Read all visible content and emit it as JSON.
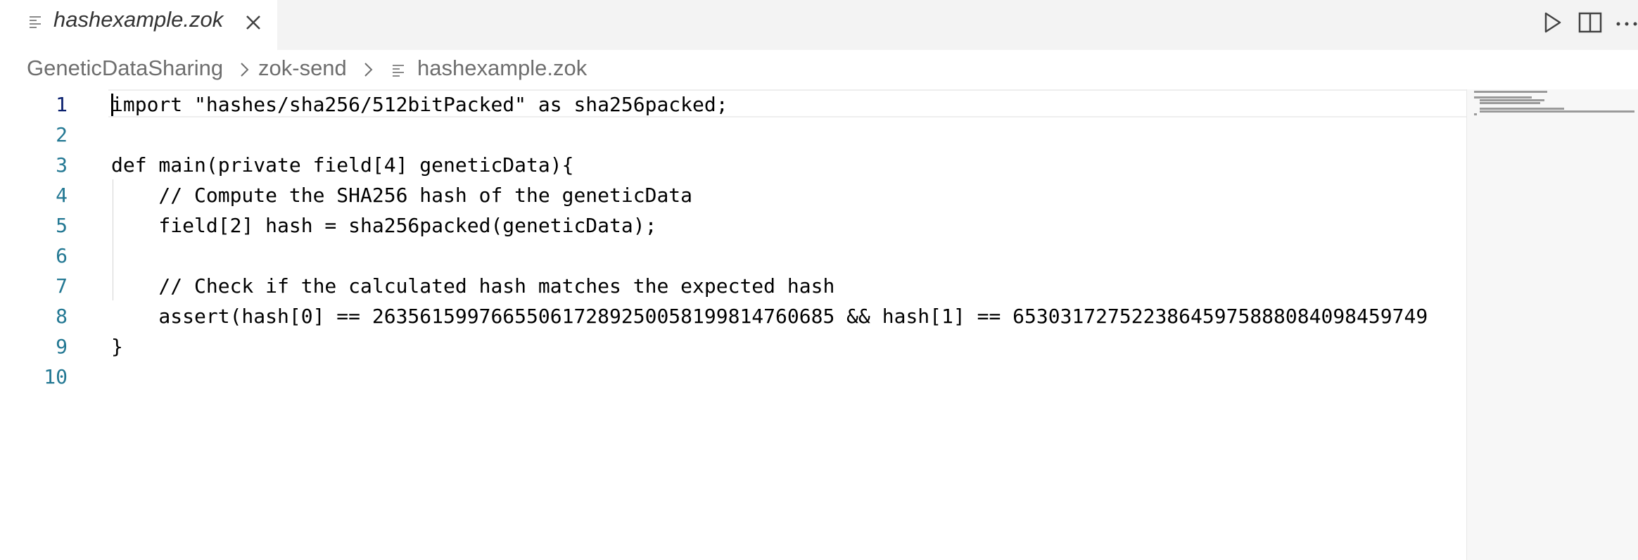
{
  "tab": {
    "title": "hashexample.zok",
    "file_icon": "lines-file-icon",
    "close_icon": "close-icon"
  },
  "actions": {
    "run_icon": "play-icon",
    "split_icon": "split-editor-icon",
    "more_icon": "ellipsis-icon"
  },
  "breadcrumb": {
    "items": [
      "GeneticDataSharing",
      "zok-send",
      "hashexample.zok"
    ],
    "separator_icon": "chevron-right-icon"
  },
  "editor": {
    "active_line": 1,
    "lines": [
      {
        "num": "1",
        "text": "import \"hashes/sha256/512bitPacked\" as sha256packed;"
      },
      {
        "num": "2",
        "text": ""
      },
      {
        "num": "3",
        "text": "def main(private field[4] geneticData){"
      },
      {
        "num": "4",
        "text": "    // Compute the SHA256 hash of the geneticData"
      },
      {
        "num": "5",
        "text": "    field[2] hash = sha256packed(geneticData);"
      },
      {
        "num": "6",
        "text": ""
      },
      {
        "num": "7",
        "text": "    // Check if the calculated hash matches the expected hash"
      },
      {
        "num": "8",
        "text": "    assert(hash[0] == 263561599766550617289250058199814760685 && hash[1] == 65303172752238645975888084098459749"
      },
      {
        "num": "9",
        "text": "}"
      },
      {
        "num": "10",
        "text": ""
      }
    ]
  },
  "colors": {
    "tabbar_bg": "#f3f3f3",
    "line_number": "#237893",
    "active_line_number": "#0b216f",
    "breadcrumb_text": "#6e6e6e"
  }
}
